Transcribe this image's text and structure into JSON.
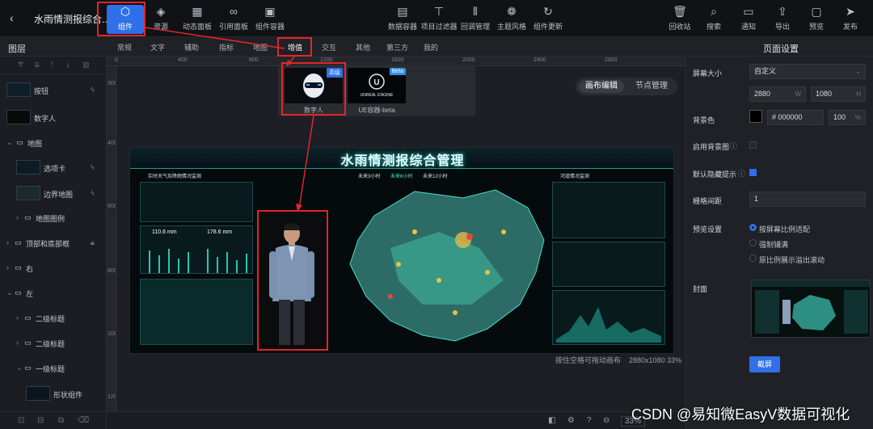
{
  "header": {
    "back_icon": "chevron-left-icon",
    "title": "水雨情测报综合...",
    "tools_left": [
      {
        "label": "组件",
        "icon": "component-icon"
      },
      {
        "label": "资源",
        "icon": "layers-icon"
      },
      {
        "label": "动态面板",
        "icon": "panel-icon"
      },
      {
        "label": "引用面板",
        "icon": "link-icon"
      },
      {
        "label": "组件容器",
        "icon": "container-icon"
      }
    ],
    "tools_center": [
      {
        "label": "数据容器",
        "icon": "data-container-icon"
      },
      {
        "label": "项目过滤器",
        "icon": "filter-icon"
      },
      {
        "label": "回调管理",
        "icon": "sliders-icon"
      },
      {
        "label": "主题风格",
        "icon": "palette-icon"
      },
      {
        "label": "组件更新",
        "icon": "refresh-icon"
      }
    ],
    "tools_right": [
      {
        "label": "回收站",
        "icon": "trash-icon"
      },
      {
        "label": "搜索",
        "icon": "search-icon"
      },
      {
        "label": "通知",
        "icon": "message-icon"
      },
      {
        "label": "导出",
        "icon": "export-icon"
      },
      {
        "label": "预览",
        "icon": "preview-icon"
      },
      {
        "label": "发布",
        "icon": "publish-icon"
      }
    ]
  },
  "subbar": {
    "layers_title": "图层",
    "component_tabs": [
      "常规",
      "文字",
      "辅助",
      "指标",
      "地图",
      "增值",
      "交互",
      "其他",
      "第三方",
      "我的"
    ],
    "active_tab": "增值",
    "page_settings_title": "页面设置"
  },
  "layers": [
    {
      "name": "按钮",
      "type": "item"
    },
    {
      "name": "数字人",
      "type": "item"
    },
    {
      "name": "地图",
      "type": "group"
    },
    {
      "name": "选项卡",
      "type": "item"
    },
    {
      "name": "边界地图",
      "type": "item"
    },
    {
      "name": "地图图例",
      "type": "group"
    },
    {
      "name": "顶部和底部框",
      "type": "group"
    },
    {
      "name": "右",
      "type": "group"
    },
    {
      "name": "左",
      "type": "group"
    },
    {
      "name": "二级标题",
      "type": "group"
    },
    {
      "name": "二级标题",
      "type": "group"
    },
    {
      "name": "一级标题",
      "type": "group"
    },
    {
      "name": "形状组件",
      "type": "item"
    }
  ],
  "ruler": {
    "h_ticks": [
      "0",
      "400",
      "800",
      "1200",
      "1600",
      "2000",
      "2400",
      "2800"
    ],
    "v_ticks": [
      "300",
      "400",
      "600",
      "800",
      "1000",
      "1200"
    ]
  },
  "dropdown": {
    "items": [
      {
        "name": "数字人",
        "tag": "高级"
      },
      {
        "name": "UE容器-beta",
        "tag": "Beta",
        "logo": "UNREAL ENGINE"
      }
    ]
  },
  "view_toggle": {
    "options": [
      "画布编辑",
      "节点管理"
    ],
    "active": "画布编辑"
  },
  "dashboard": {
    "title": "水雨情测报综合管理",
    "left_title": "实时天气及降雨情况监测",
    "time_tabs": [
      "未来3小时",
      "未来6小时",
      "未来12小时"
    ],
    "right_title": "河道情况监测",
    "left_values": [
      "110.6 mm",
      "178.6 mm"
    ]
  },
  "canvas_status": {
    "hint": "按住空格可拖动画布",
    "size_zoom": "2880x1080 33%"
  },
  "canvas_bottom": {
    "zoom": "33%"
  },
  "page_settings": {
    "screen_size_label": "屏幕大小",
    "screen_size_value": "自定义",
    "width": "2880",
    "width_unit": "W",
    "height": "1080",
    "height_unit": "H",
    "bg_color_label": "背景色",
    "bg_color_hex": "# 000000",
    "bg_opacity": "100",
    "bg_opacity_unit": "%",
    "bg_image_label": "启用背景图",
    "hidden_tip_label": "默认隐藏提示",
    "grid_label": "栅格间距",
    "grid_value": "1",
    "preview_label": "预览设置",
    "preview_options": [
      "按屏幕比例适配",
      "强制铺满",
      "原比例展示溢出滚动"
    ],
    "cover_label": "封面",
    "screenshot_button": "截屏"
  },
  "watermark": "CSDN @易知微EasyV数据可视化",
  "colors": {
    "accent": "#2f6fe7",
    "highlight_red": "#e0262a",
    "dashboard_teal": "#25c8a8"
  }
}
